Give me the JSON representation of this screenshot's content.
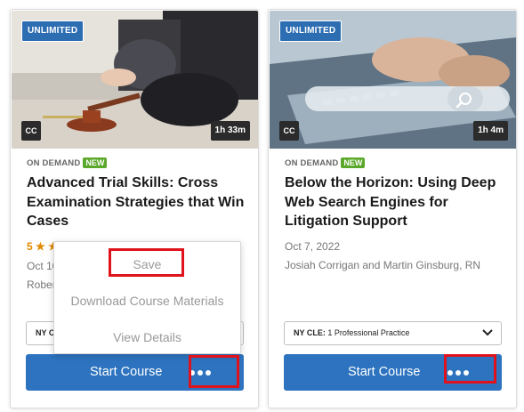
{
  "cards": [
    {
      "thumbnail_badge": "UNLIMITED",
      "cc_label": "CC",
      "duration": "1h 33m",
      "format_label": "ON DEMAND",
      "new_label": "NEW",
      "title": "Advanced Trial Skills: Cross Examination Strategies that Win Cases",
      "rating": "5 ★ ★",
      "date": "Oct 10",
      "author": "Rober",
      "cle_state": "NY C",
      "cle_category": "",
      "start_label": "Start Course"
    },
    {
      "thumbnail_badge": "UNLIMITED",
      "cc_label": "CC",
      "duration": "1h 4m",
      "format_label": "ON DEMAND",
      "new_label": "NEW",
      "title": "Below the Horizon: Using Deep Web Search Engines for Litigation Support",
      "date": "Oct 7, 2022",
      "author": "Josiah Corrigan and Martin Ginsburg, RN",
      "cle_state": "NY CLE:",
      "cle_category": "1 Professional Practice",
      "start_label": "Start Course"
    }
  ],
  "more_menu": {
    "items": [
      "Save",
      "Download Course Materials",
      "View Details"
    ]
  },
  "colors": {
    "primary_button": "#2d73bf",
    "unlimited_badge": "#2d6db2",
    "new_badge": "#5aa82a",
    "rating": "#e08a00",
    "highlight": "#e0121b"
  },
  "icons": {
    "more": "ellipsis-icon",
    "select": "chevron-down-icon",
    "search": "search-icon"
  }
}
